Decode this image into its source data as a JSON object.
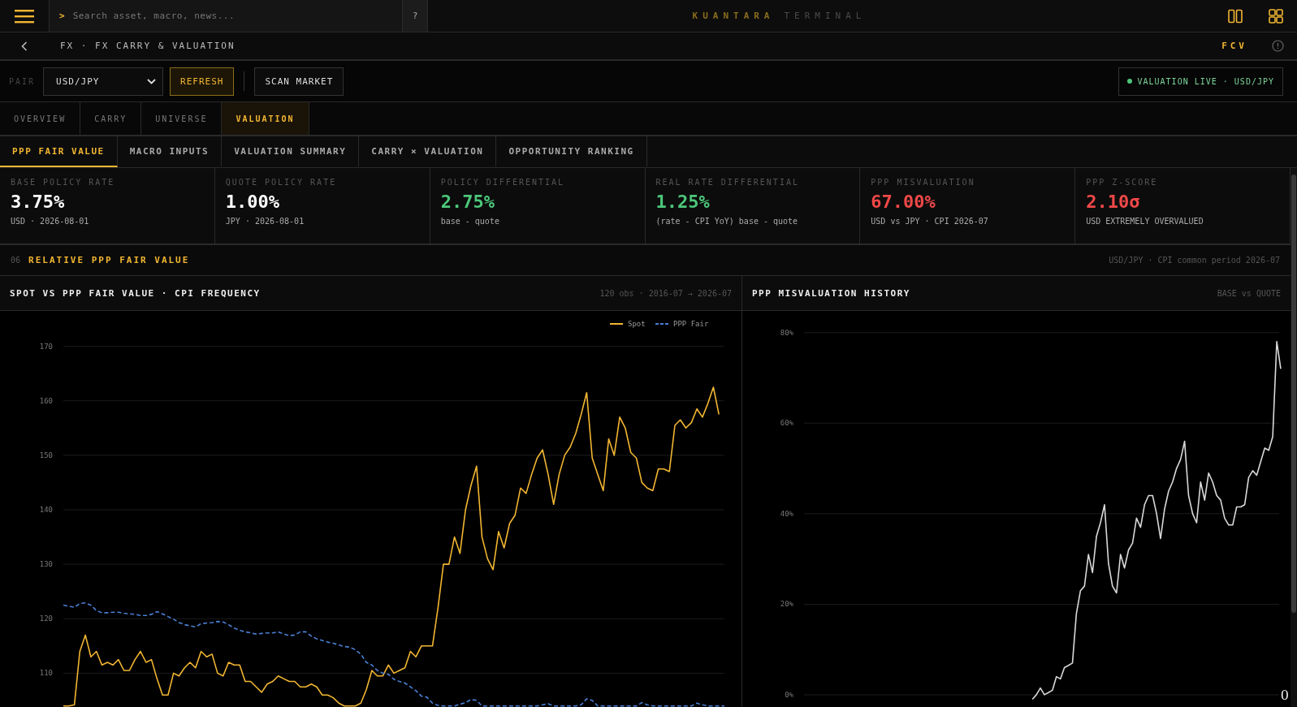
{
  "header": {
    "search": {
      "prompt": ">",
      "placeholder": "Search asset, macro, news...",
      "help": "?"
    },
    "brand": {
      "name": "KUANTARA",
      "suffix": "TERMINAL"
    }
  },
  "breadcrumb": {
    "title": "FX · FX CARRY & VALUATION",
    "code": "FCV"
  },
  "toolbar": {
    "pair_label": "PAIR",
    "pair": "USD/JPY",
    "buttons": [
      {
        "label": "REFRESH",
        "kind": "primary"
      },
      {
        "label": "SCAN MARKET",
        "kind": "secondary"
      }
    ],
    "status": {
      "label": "VALUATION LIVE · USD/JPY",
      "live": true
    }
  },
  "tabs": [
    {
      "label": "OVERVIEW",
      "selected": false
    },
    {
      "label": "CARRY",
      "selected": false
    },
    {
      "label": "UNIVERSE",
      "selected": false
    },
    {
      "label": "VALUATION",
      "selected": true
    }
  ],
  "subtabs": [
    {
      "label": "PPP FAIR VALUE",
      "selected": true
    },
    {
      "label": "MACRO INPUTS",
      "selected": false
    },
    {
      "label": "VALUATION SUMMARY",
      "selected": false
    },
    {
      "label": "CARRY × VALUATION",
      "selected": false
    },
    {
      "label": "OPPORTUNITY RANKING",
      "selected": false
    }
  ],
  "metrics": [
    {
      "label": "BASE POLICY RATE",
      "value": "3.75%",
      "note": "USD · 2026-08-01",
      "color": "#ffffff"
    },
    {
      "label": "QUOTE POLICY RATE",
      "value": "1.00%",
      "note": "JPY · 2026-08-01",
      "color": "#ffffff"
    },
    {
      "label": "POLICY DIFFERENTIAL",
      "value": "2.75%",
      "note": "base - quote",
      "color": "#4cc77a"
    },
    {
      "label": "REAL RATE DIFFERENTIAL",
      "value": "1.25%",
      "note": "(rate - CPI YoY) base - quote",
      "color": "#4cc77a"
    },
    {
      "label": "PPP MISVALUATION",
      "value": "67.00%",
      "note": "USD vs JPY · CPI 2026-07",
      "color": "#f04848"
    },
    {
      "label": "PPP Z-SCORE",
      "value": "2.10σ",
      "note": "USD EXTREMELY OVERVALUED",
      "color": "#f04848"
    }
  ],
  "section": {
    "number": "06",
    "title": "RELATIVE PPP FAIR VALUE",
    "meta": "USD/JPY · CPI common period 2026-07"
  },
  "panels": [
    {
      "title": "SPOT VS PPP FAIR VALUE · CPI FREQUENCY",
      "meta": "120 obs · 2016-07 → 2026-07",
      "chart_data": {
        "type": "line",
        "ylim": [
          103.8,
          176.5
        ],
        "yticks": [
          110,
          120,
          130,
          140,
          150,
          160,
          170
        ],
        "grid": true,
        "legend": "top-right",
        "series": [
          {
            "name": "Spot",
            "color": "#f2b632",
            "line_style": "solid",
            "values": [
              104,
              104,
              104.2,
              114,
              117,
              113,
              114,
              111.5,
              112,
              111.5,
              112.5,
              110.5,
              110.5,
              112.5,
              114,
              112,
              112.5,
              109,
              106,
              106,
              110,
              109.5,
              111,
              112,
              111,
              114,
              113,
              113.5,
              110,
              109.5,
              112,
              111.5,
              111.5,
              108.5,
              108.5,
              107.5,
              106.5,
              108,
              108.5,
              109.5,
              109,
              108.5,
              108.5,
              107.5,
              107.5,
              108,
              107.5,
              106,
              106,
              105.5,
              104.5,
              104,
              104,
              104,
              104.5,
              107,
              110.5,
              109.5,
              109.5,
              111.5,
              110,
              110.5,
              111,
              114,
              113,
              115,
              115,
              115,
              122,
              130,
              130,
              135,
              132,
              140,
              144.5,
              148,
              135,
              131,
              129,
              136,
              133,
              137.5,
              139,
              144,
              143,
              146.5,
              149.5,
              151,
              146.5,
              141,
              146.5,
              150,
              151.5,
              154,
              157.5,
              161.5,
              149.5,
              146.5,
              143.5,
              153,
              150,
              157,
              155,
              150.5,
              149.5,
              145,
              144,
              143.5,
              147.5,
              147.5,
              147,
              155.5,
              156.5,
              155,
              156,
              158.5,
              157,
              159.5,
              162.5,
              157.5
            ]
          },
          {
            "name": "PPP Fair",
            "color": "#4a7fd4",
            "line_style": "dashed",
            "values": [
              122.5,
              122.3,
              122.1,
              122.8,
              122.9,
              122.5,
              121.5,
              121.1,
              121.1,
              121.2,
              121.2,
              121,
              120.9,
              120.8,
              120.6,
              120.6,
              120.8,
              121.3,
              120.9,
              120.4,
              119.9,
              119.3,
              118.9,
              118.7,
              118.5,
              119.1,
              119.2,
              119.3,
              119.5,
              119.4,
              118.9,
              118.3,
              117.9,
              117.6,
              117.4,
              117.2,
              117.3,
              117.4,
              117.4,
              117.6,
              117.2,
              116.9,
              117,
              117.6,
              117.6,
              116.8,
              116.3,
              116,
              115.7,
              115.5,
              115.2,
              114.9,
              114.8,
              114.3,
              113.5,
              112,
              111.5,
              110.5,
              110,
              109.8,
              108.9,
              108.5,
              108.2,
              107.5,
              106.8,
              105.8,
              105.6,
              104.5,
              104.1,
              104,
              104,
              104,
              104.3,
              104.6,
              105.2,
              105,
              104,
              104,
              104,
              104,
              104,
              104,
              104,
              104,
              104,
              104,
              104,
              104.2,
              104.4,
              104,
              104,
              104,
              104,
              104,
              104.2,
              105.3,
              105,
              104,
              104,
              104,
              104,
              104,
              104,
              104,
              104,
              104.6,
              104.2,
              104,
              104,
              104,
              104,
              104,
              104,
              104,
              104,
              104.5,
              104.2,
              104,
              104,
              104,
              104
            ]
          }
        ]
      }
    },
    {
      "title": "PPP MISVALUATION HISTORY",
      "meta": "BASE vs QUOTE",
      "end_label": "0",
      "chart_data": {
        "type": "line",
        "ylim": [
          -2.7,
          84.8
        ],
        "grid": true,
        "yticks": [
          {
            "value": 0,
            "label": "0%"
          },
          {
            "value": 20,
            "label": "20%"
          },
          {
            "value": 40,
            "label": "40%"
          },
          {
            "value": 60,
            "label": "60%"
          },
          {
            "value": 80,
            "label": "80%"
          }
        ],
        "series": [
          {
            "color": "#d9d9d9",
            "line_style": "solid",
            "values": [
              null,
              null,
              null,
              null,
              null,
              null,
              null,
              null,
              null,
              null,
              null,
              null,
              null,
              null,
              null,
              null,
              null,
              null,
              null,
              null,
              null,
              null,
              null,
              null,
              null,
              null,
              null,
              null,
              null,
              null,
              null,
              null,
              null,
              null,
              null,
              null,
              null,
              null,
              null,
              null,
              null,
              null,
              null,
              null,
              null,
              null,
              null,
              null,
              null,
              null,
              null,
              null,
              null,
              null,
              null,
              null,
              null,
              -1,
              0,
              1.5,
              0,
              0.5,
              1,
              4,
              3.5,
              6,
              6.5,
              7,
              18,
              23,
              24,
              31,
              27,
              35,
              38,
              42,
              29,
              24,
              22.5,
              31,
              28,
              32,
              33.5,
              39,
              37,
              42,
              44,
              44,
              40,
              34.5,
              41,
              45,
              47,
              50,
              52,
              56,
              44,
              40,
              38,
              47,
              43,
              49,
              47,
              44,
              43,
              39,
              37.5,
              37.5,
              41.5,
              41.5,
              42,
              48,
              49.5,
              48.5,
              51.5,
              54.5,
              54,
              57,
              78,
              72
            ]
          }
        ]
      }
    }
  ]
}
